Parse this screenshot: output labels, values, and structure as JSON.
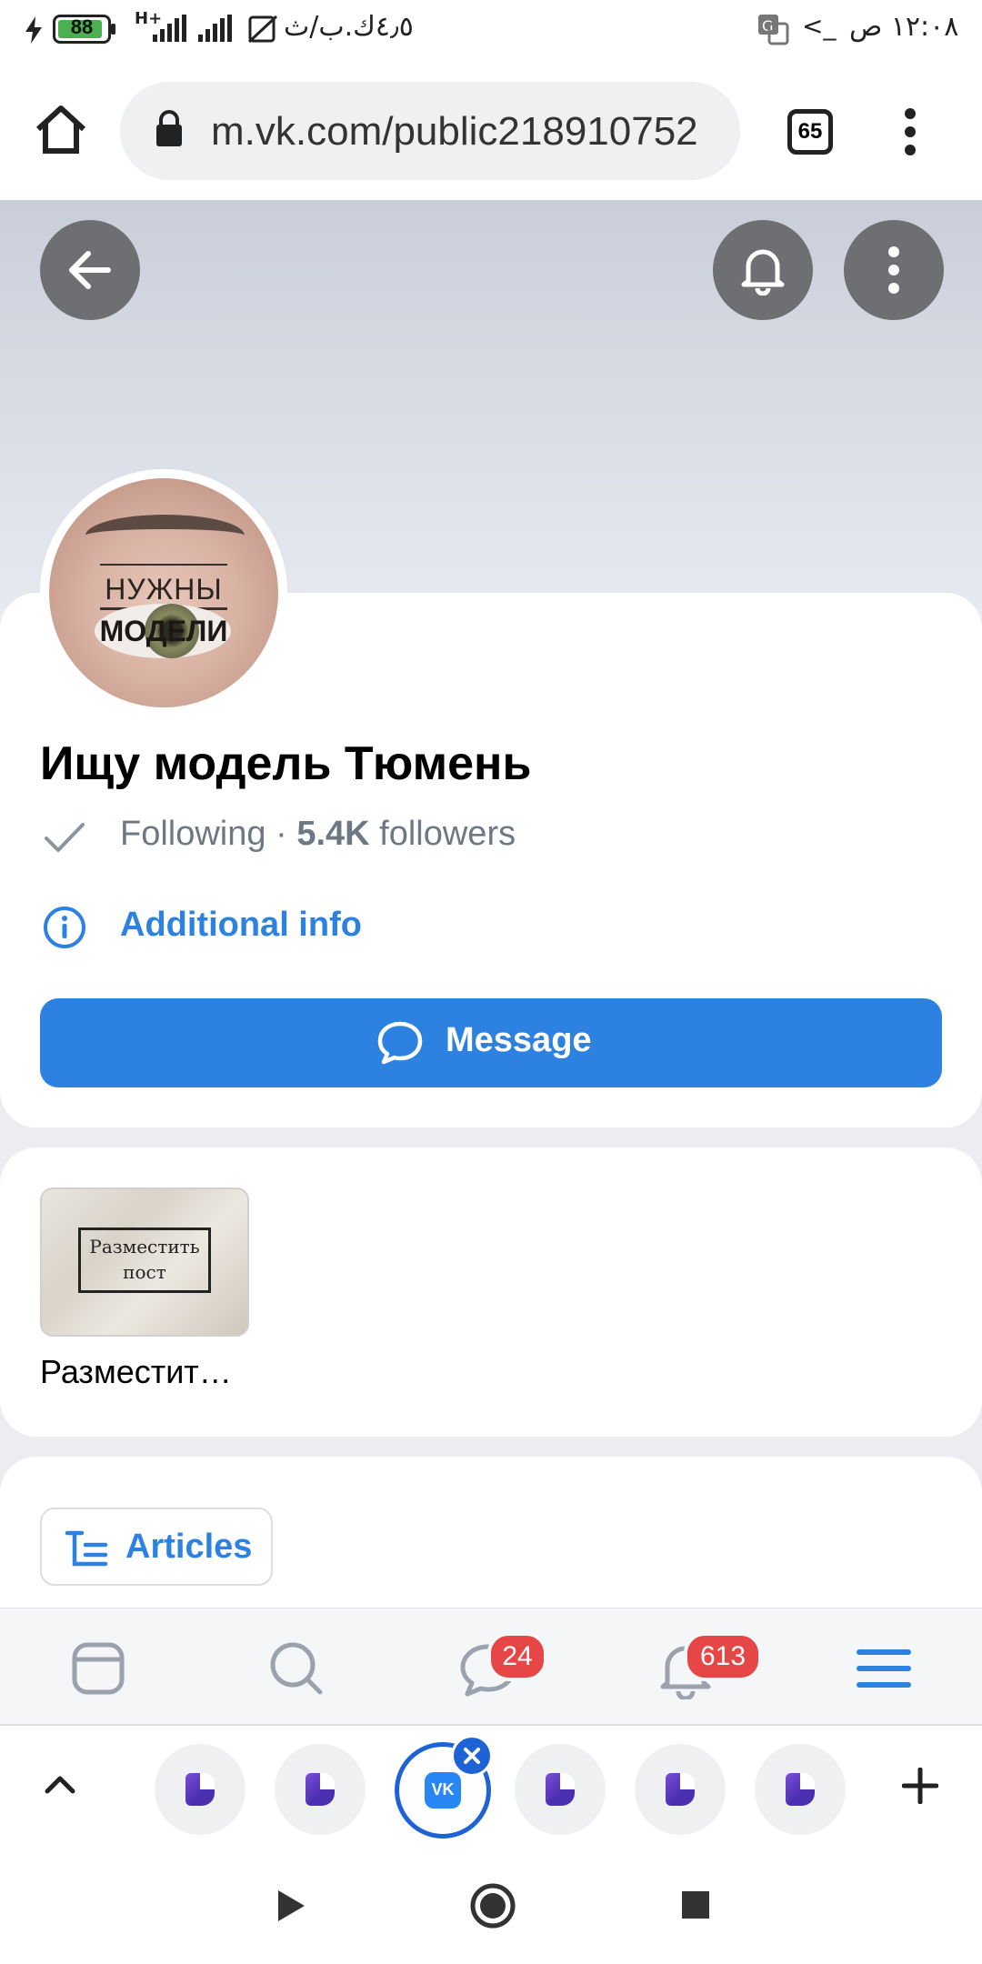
{
  "status_bar": {
    "time": "١٢:٠٨ ص",
    "battery": "88",
    "network": "H+",
    "data_rate": "٤٫٥ك.ب/ث"
  },
  "browser": {
    "url": "m.vk.com/public218910752",
    "tab_count": "65"
  },
  "community": {
    "avatar_line1": "НУЖНЫ",
    "avatar_line2": "МОДЕЛИ",
    "name": "Ищу модель Тюмень",
    "following_label": "Following",
    "separator": " · ",
    "followers_count": "5.4K",
    "followers_label": " followers",
    "additional_info": "Additional info",
    "message_button": "Message"
  },
  "album": {
    "thumb_text": "Разместить пост",
    "caption": "Разместит…"
  },
  "tabs": {
    "articles": "Articles"
  },
  "app_nav": {
    "messages_badge": "24",
    "notifications_badge": "613"
  },
  "colors": {
    "accent": "#2d81e0",
    "badge": "#e64646"
  }
}
